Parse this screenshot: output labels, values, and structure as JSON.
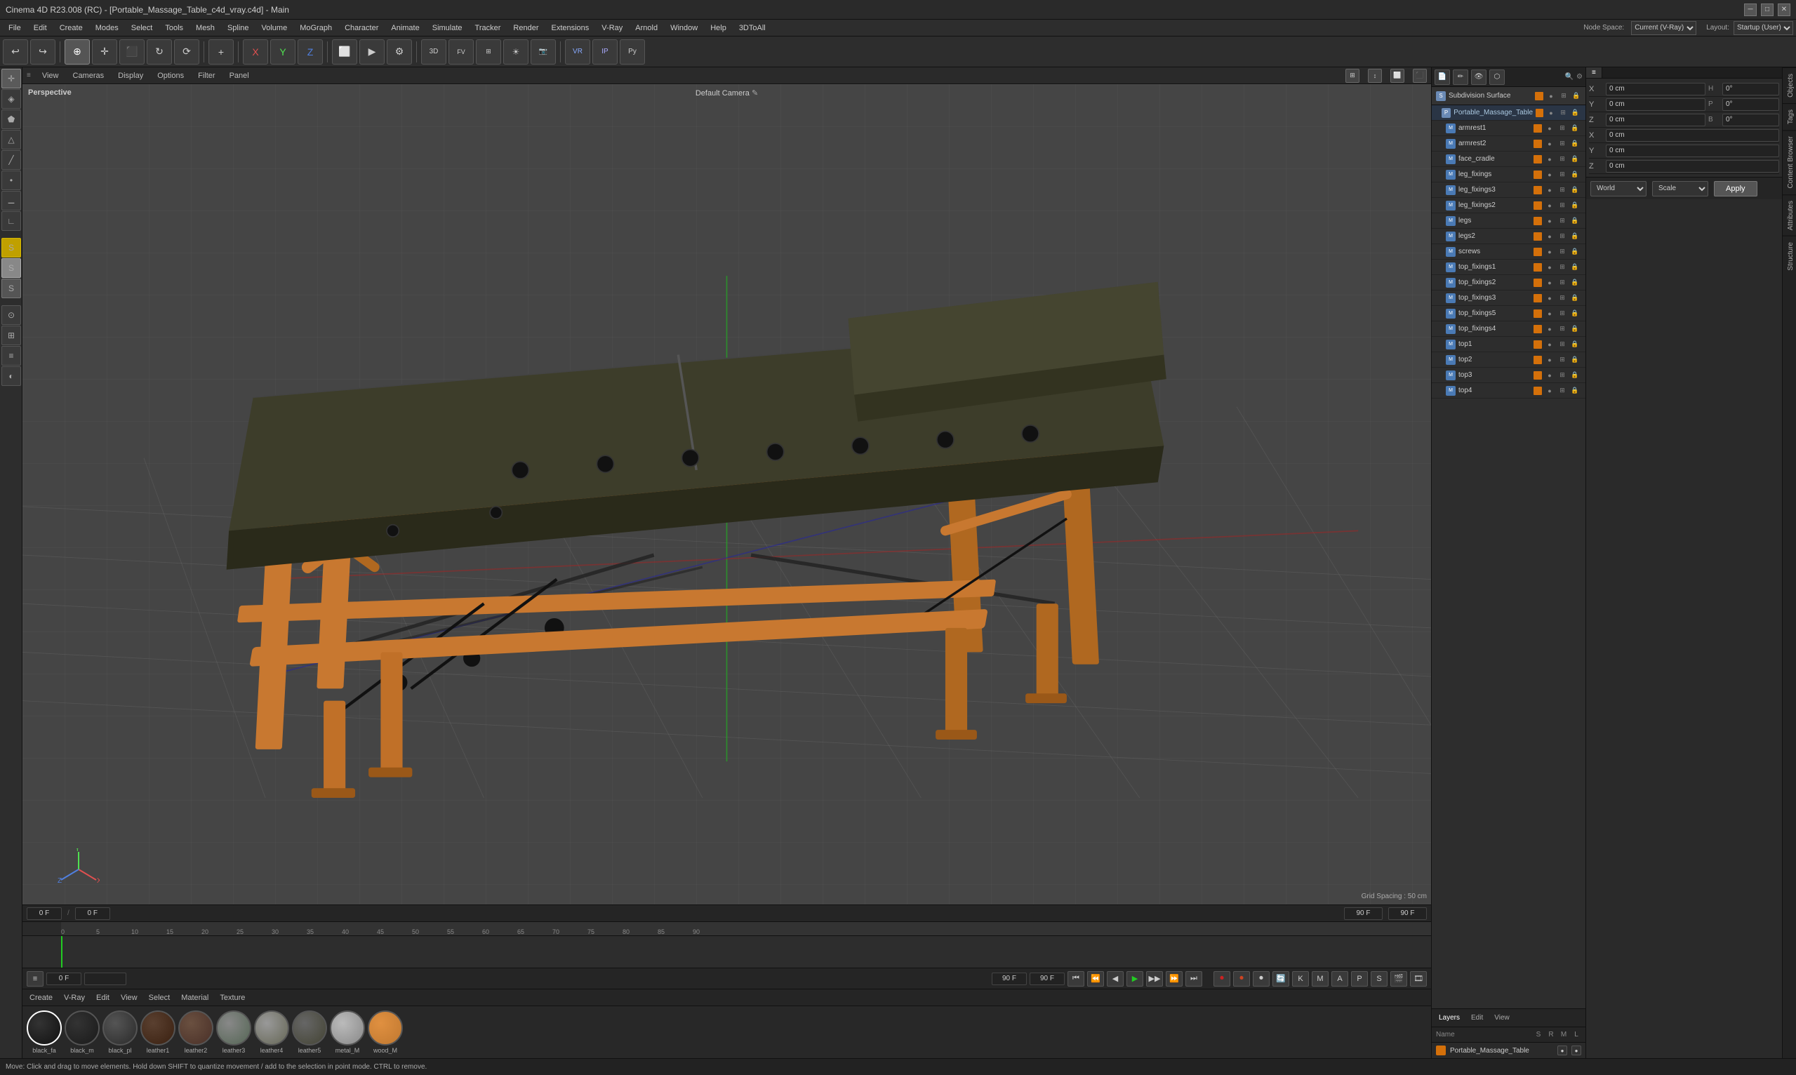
{
  "window": {
    "title": "Cinema 4D R23.008 (RC) - [Portable_Massage_Table_c4d_vray.c4d] - Main"
  },
  "menubar": {
    "items": [
      "File",
      "Edit",
      "Create",
      "Modes",
      "Select",
      "Tools",
      "Mesh",
      "Spline",
      "Volume",
      "MoGraph",
      "Character",
      "Animate",
      "Simulate",
      "Tracker",
      "Render",
      "Extensions",
      "V-Ray",
      "Arnold",
      "Window",
      "Help",
      "3DToAll"
    ]
  },
  "viewport": {
    "label": "Perspective",
    "camera": "Default Camera",
    "grid_spacing": "Grid Spacing : 50 cm"
  },
  "viewport_toolbar": {
    "items": [
      "View",
      "Cameras",
      "Display",
      "Filter",
      "Panel"
    ]
  },
  "object_list": {
    "root": "Subdivision Surface",
    "parent": "Portable_Massage_Table",
    "items": [
      "armrest1",
      "armrest2",
      "face_cradle",
      "leg_fixings",
      "leg_fixings3",
      "leg_fixings2",
      "legs",
      "legs2",
      "screws",
      "top_fixings1",
      "top_fixings2",
      "top_fixings3",
      "top_fixings5",
      "top_fixings4",
      "top1",
      "top2",
      "top3",
      "top4"
    ]
  },
  "layers_panel": {
    "tabs": [
      "Layers",
      "Edit",
      "View"
    ],
    "active_tab": "Layers",
    "items": [
      {
        "name": "Portable_Massage_Table",
        "color": "#d4700a"
      }
    ]
  },
  "properties": {
    "x_label": "X",
    "y_label": "Y",
    "z_label": "Z",
    "x_pos": "0 cm",
    "y_pos": "0 cm",
    "z_pos": "0 cm",
    "h_val": "0°",
    "p_val": "0°",
    "b_val": "0°",
    "x_scale": "0 cm",
    "y_scale": "0 cm",
    "z_scale": "0 cm"
  },
  "transform": {
    "coord_system": "World",
    "transform_type": "Scale",
    "apply_label": "Apply"
  },
  "timeline": {
    "current_frame": "0 F",
    "end_frame": "90 F",
    "fps": "0 F",
    "fps2": "90 F",
    "ruler_marks": [
      "0",
      "5",
      "10",
      "15",
      "20",
      "25",
      "30",
      "35",
      "40",
      "45",
      "50",
      "55",
      "60",
      "65",
      "70",
      "75",
      "80",
      "85",
      "90"
    ]
  },
  "materials": {
    "items": [
      {
        "name": "black_fa",
        "color": "#111111",
        "selected": true
      },
      {
        "name": "black_m",
        "color": "#1a1a1a",
        "selected": false
      },
      {
        "name": "black_pl",
        "color": "#2a2a2a",
        "selected": false
      },
      {
        "name": "leather1",
        "color": "#3a3020",
        "selected": false
      },
      {
        "name": "leather2",
        "color": "#4a3a28",
        "selected": false
      },
      {
        "name": "leather3",
        "color": "#555545",
        "selected": false
      },
      {
        "name": "leather4",
        "color": "#666656",
        "selected": false
      },
      {
        "name": "leather5",
        "color": "#444434",
        "selected": false
      },
      {
        "name": "metal_M",
        "color": "#888888",
        "selected": false
      },
      {
        "name": "wood_M",
        "color": "#c87830",
        "selected": false
      }
    ]
  },
  "playback": {
    "current": "0 F",
    "end": "90 F",
    "fps_current": "0 F",
    "fps_end": "90 F"
  },
  "status": {
    "message": "Move: Click and drag to move elements. Hold down SHIFT to quantize movement / add to the selection in point mode. CTRL to remove."
  },
  "right_side_tabs": [
    "Objects",
    "Tags",
    "Content Browser",
    "Attributes",
    "Structure"
  ],
  "node_space_label": "Node Space:",
  "node_space_value": "Current (V-Ray)",
  "layout_label": "Layout:",
  "layout_value": "Startup (User)"
}
